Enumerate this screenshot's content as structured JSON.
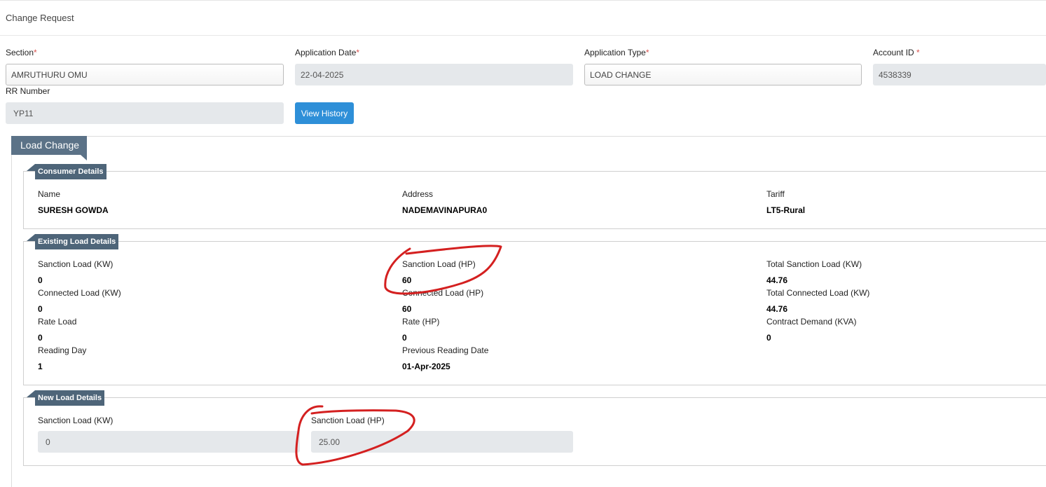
{
  "header": {
    "title": "Change Request"
  },
  "form": {
    "section": {
      "label": "Section",
      "required_mark": "*",
      "value": "AMRUTHURU OMU"
    },
    "application_date": {
      "label": "Application Date",
      "required_mark": "*",
      "value": "22-04-2025"
    },
    "application_type": {
      "label": "Application Type",
      "required_mark": "*",
      "value": "LOAD CHANGE"
    },
    "account_id": {
      "label": "Account ID",
      "required_mark": " *",
      "value": "4538339"
    },
    "rr_number": {
      "label": "RR Number",
      "value": "YP11"
    },
    "view_history_label": "View History"
  },
  "load_change": {
    "tab_label": "Load Change",
    "consumer_details": {
      "title": "Consumer Details",
      "fields": [
        {
          "label": "Name",
          "value": "SURESH GOWDA"
        },
        {
          "label": "Address",
          "value": "NADEMAVINAPURA0"
        },
        {
          "label": "Tariff",
          "value": "LT5-Rural"
        }
      ]
    },
    "existing_load_details": {
      "title": "Existing Load Details",
      "fields": [
        {
          "label": "Sanction Load (KW)",
          "value": "0"
        },
        {
          "label": "Sanction Load (HP)",
          "value": "60"
        },
        {
          "label": "Total Sanction Load (KW)",
          "value": "44.76"
        },
        {
          "label": "Connected Load (KW)",
          "value": "0"
        },
        {
          "label": "Connected Load (HP)",
          "value": "60"
        },
        {
          "label": "Total Connected Load (KW)",
          "value": "44.76"
        },
        {
          "label": "Rate Load",
          "value": "0"
        },
        {
          "label": "Rate (HP)",
          "value": "0"
        },
        {
          "label": "Contract Demand (KVA)",
          "value": "0"
        },
        {
          "label": "Reading Day",
          "value": "1"
        },
        {
          "label": "Previous Reading Date",
          "value": "01-Apr-2025"
        }
      ]
    },
    "new_load_details": {
      "title": "New Load Details",
      "sanction_load_kw": {
        "label": "Sanction Load (KW)",
        "value": "0"
      },
      "sanction_load_hp": {
        "label": "Sanction Load (HP)",
        "value": "25.00"
      }
    }
  },
  "annotation_color": "#d42020"
}
